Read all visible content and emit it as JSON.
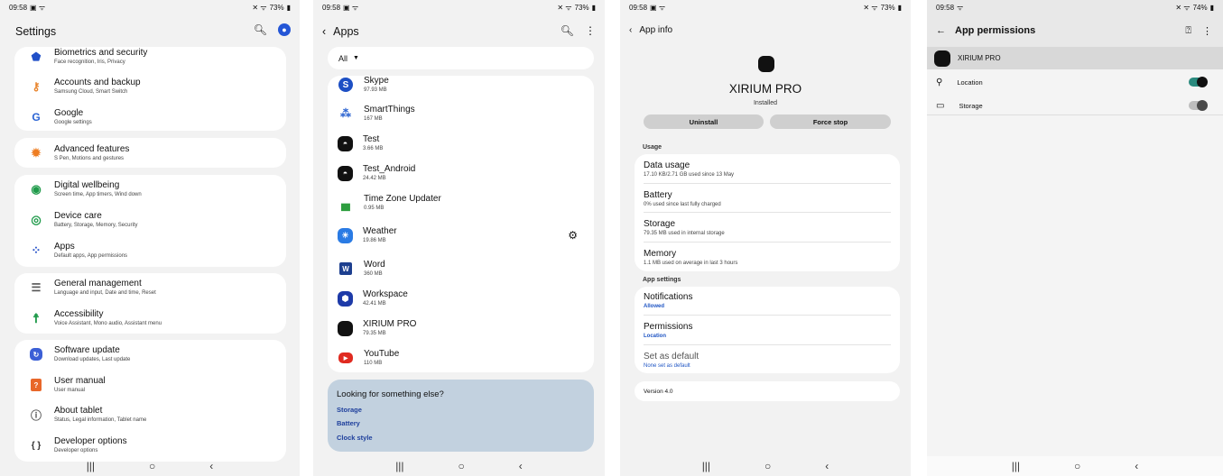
{
  "s1": {
    "status": {
      "time": "09:58",
      "right": "73%"
    },
    "title": "Settings",
    "items": [
      {
        "t": "Biometrics and security",
        "s": "Face recognition, Iris, Privacy"
      },
      {
        "t": "Accounts and backup",
        "s": "Samsung Cloud, Smart Switch"
      },
      {
        "t": "Google",
        "s": "Google settings"
      },
      {
        "t": "Advanced features",
        "s": "S Pen, Motions and gestures"
      },
      {
        "t": "Digital wellbeing",
        "s": "Screen time, App timers, Wind down"
      },
      {
        "t": "Device care",
        "s": "Battery, Storage, Memory, Security"
      },
      {
        "t": "Apps",
        "s": "Default apps, App permissions"
      },
      {
        "t": "General management",
        "s": "Language and input, Date and time, Reset"
      },
      {
        "t": "Accessibility",
        "s": "Voice Assistant, Mono audio, Assistant menu"
      },
      {
        "t": "Software update",
        "s": "Download updates, Last update"
      },
      {
        "t": "User manual",
        "s": "User manual"
      },
      {
        "t": "About tablet",
        "s": "Status, Legal information, Tablet name"
      },
      {
        "t": "Developer options",
        "s": "Developer options"
      }
    ]
  },
  "s2": {
    "status": {
      "time": "09:58",
      "right": "73%"
    },
    "title": "Apps",
    "filter": "All",
    "apps": [
      {
        "t": "Skype",
        "s": "97.93 MB"
      },
      {
        "t": "SmartThings",
        "s": "167 MB"
      },
      {
        "t": "Test",
        "s": "3.66 MB"
      },
      {
        "t": "Test_Android",
        "s": "24.42 MB"
      },
      {
        "t": "Time Zone Updater",
        "s": "0.95 MB"
      },
      {
        "t": "Weather",
        "s": "19.86 MB"
      },
      {
        "t": "Word",
        "s": "360 MB"
      },
      {
        "t": "Workspace",
        "s": "42.41 MB"
      },
      {
        "t": "XIRIUM PRO",
        "s": "79.35 MB"
      },
      {
        "t": "YouTube",
        "s": "110 MB"
      }
    ],
    "looking": {
      "title": "Looking for something else?",
      "links": [
        "Storage",
        "Battery",
        "Clock style"
      ]
    }
  },
  "s3": {
    "status": {
      "time": "09:58",
      "right": "73%"
    },
    "title": "App info",
    "app_name": "XIRIUM PRO",
    "installed": "Installed",
    "uninstall": "Uninstall",
    "force_stop": "Force stop",
    "usage_header": "Usage",
    "usage": [
      {
        "t": "Data usage",
        "s": "17.10 KB/2.71 GB used since 13 May"
      },
      {
        "t": "Battery",
        "s": "0% used since last fully charged"
      },
      {
        "t": "Storage",
        "s": "79.35 MB used in internal storage"
      },
      {
        "t": "Memory",
        "s": "1.1 MB used on average in last 3 hours"
      }
    ],
    "settings_header": "App settings",
    "settings": [
      {
        "t": "Notifications",
        "s": "Allowed"
      },
      {
        "t": "Permissions",
        "s": "Location"
      },
      {
        "t": "Set as default",
        "s": "None set as default"
      }
    ],
    "version": "Version 4.0"
  },
  "s4": {
    "status": {
      "time": "09:58",
      "right": "74%"
    },
    "title": "App permissions",
    "app_name": "XIRIUM PRO",
    "perms": [
      {
        "t": "Location",
        "on": true
      },
      {
        "t": "Storage",
        "on": false
      }
    ]
  }
}
